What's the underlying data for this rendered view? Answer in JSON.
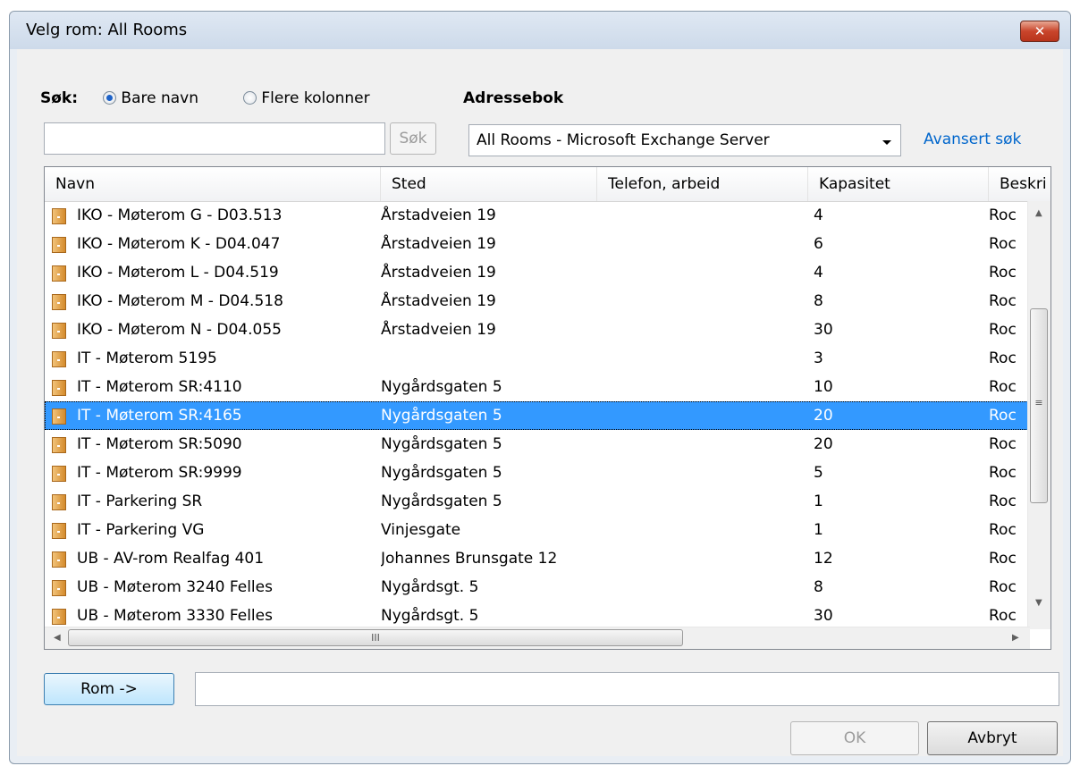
{
  "window": {
    "title": "Velg rom: All Rooms",
    "close_glyph": "✕"
  },
  "search": {
    "label": "Søk:",
    "option_name_only": "Bare navn",
    "option_more_columns": "Flere kolonner",
    "selected_option": "Bare navn",
    "input_value": "",
    "button_label": "Søk"
  },
  "addressbook": {
    "label": "Adressebok",
    "selected": "All Rooms - Microsoft Exchange Server",
    "advanced_link": "Avansert søk"
  },
  "columns": [
    "Navn",
    "Sted",
    "Telefon, arbeid",
    "Kapasitet",
    "Beskri"
  ],
  "rows": [
    {
      "name": "IKO - Møterom G - D03.513",
      "place": "Årstadveien 19",
      "phone": "",
      "capacity": "4",
      "desc": "Roc"
    },
    {
      "name": "IKO - Møterom K - D04.047",
      "place": "Årstadveien 19",
      "phone": "",
      "capacity": "6",
      "desc": "Roc"
    },
    {
      "name": "IKO - Møterom L -  D04.519",
      "place": "Årstadveien 19",
      "phone": "",
      "capacity": "4",
      "desc": "Roc"
    },
    {
      "name": "IKO - Møterom M - D04.518",
      "place": "Årstadveien 19",
      "phone": "",
      "capacity": "8",
      "desc": "Roc"
    },
    {
      "name": "IKO - Møterom N - D04.055",
      "place": "Årstadveien 19",
      "phone": "",
      "capacity": "30",
      "desc": "Roc"
    },
    {
      "name": "IT - Møterom 5195",
      "place": "",
      "phone": "",
      "capacity": "3",
      "desc": "Roc"
    },
    {
      "name": "IT - Møterom SR:4110",
      "place": "Nygårdsgaten 5",
      "phone": "",
      "capacity": "10",
      "desc": "Roc"
    },
    {
      "name": "IT - Møterom SR:4165",
      "place": "Nygårdsgaten 5",
      "phone": "",
      "capacity": "20",
      "desc": "Roc",
      "selected": true
    },
    {
      "name": "IT - Møterom SR:5090",
      "place": "Nygårdsgaten 5",
      "phone": "",
      "capacity": "20",
      "desc": "Roc"
    },
    {
      "name": "IT - Møterom SR:9999",
      "place": "Nygårdsgaten 5",
      "phone": "",
      "capacity": "5",
      "desc": "Roc"
    },
    {
      "name": "IT - Parkering SR",
      "place": "Nygårdsgaten 5",
      "phone": "",
      "capacity": "1",
      "desc": "Roc"
    },
    {
      "name": "IT - Parkering VG",
      "place": "Vinjesgate",
      "phone": "",
      "capacity": "1",
      "desc": "Roc"
    },
    {
      "name": "UB - AV-rom Realfag 401",
      "place": "Johannes Brunsgate 12",
      "phone": "",
      "capacity": "12",
      "desc": "Roc"
    },
    {
      "name": "UB - Møterom 3240 Felles",
      "place": "Nygårdsgt. 5",
      "phone": "",
      "capacity": "8",
      "desc": "Roc"
    },
    {
      "name": "UB - Møterom 3330 Felles",
      "place": "Nygårdsgt. 5",
      "phone": "",
      "capacity": "30",
      "desc": "Roc"
    }
  ],
  "scrollbars": {
    "vertical_grip": "≡",
    "horizontal_grip": "III",
    "up": "▲",
    "down": "▼",
    "left": "◀",
    "right": "▶"
  },
  "footer": {
    "rooms_button": "Rom ->",
    "rooms_value": "",
    "ok_button": "OK",
    "cancel_button": "Avbryt"
  },
  "colors": {
    "selection": "#3399ff",
    "link": "#0066cc",
    "close": "#c9452b"
  }
}
